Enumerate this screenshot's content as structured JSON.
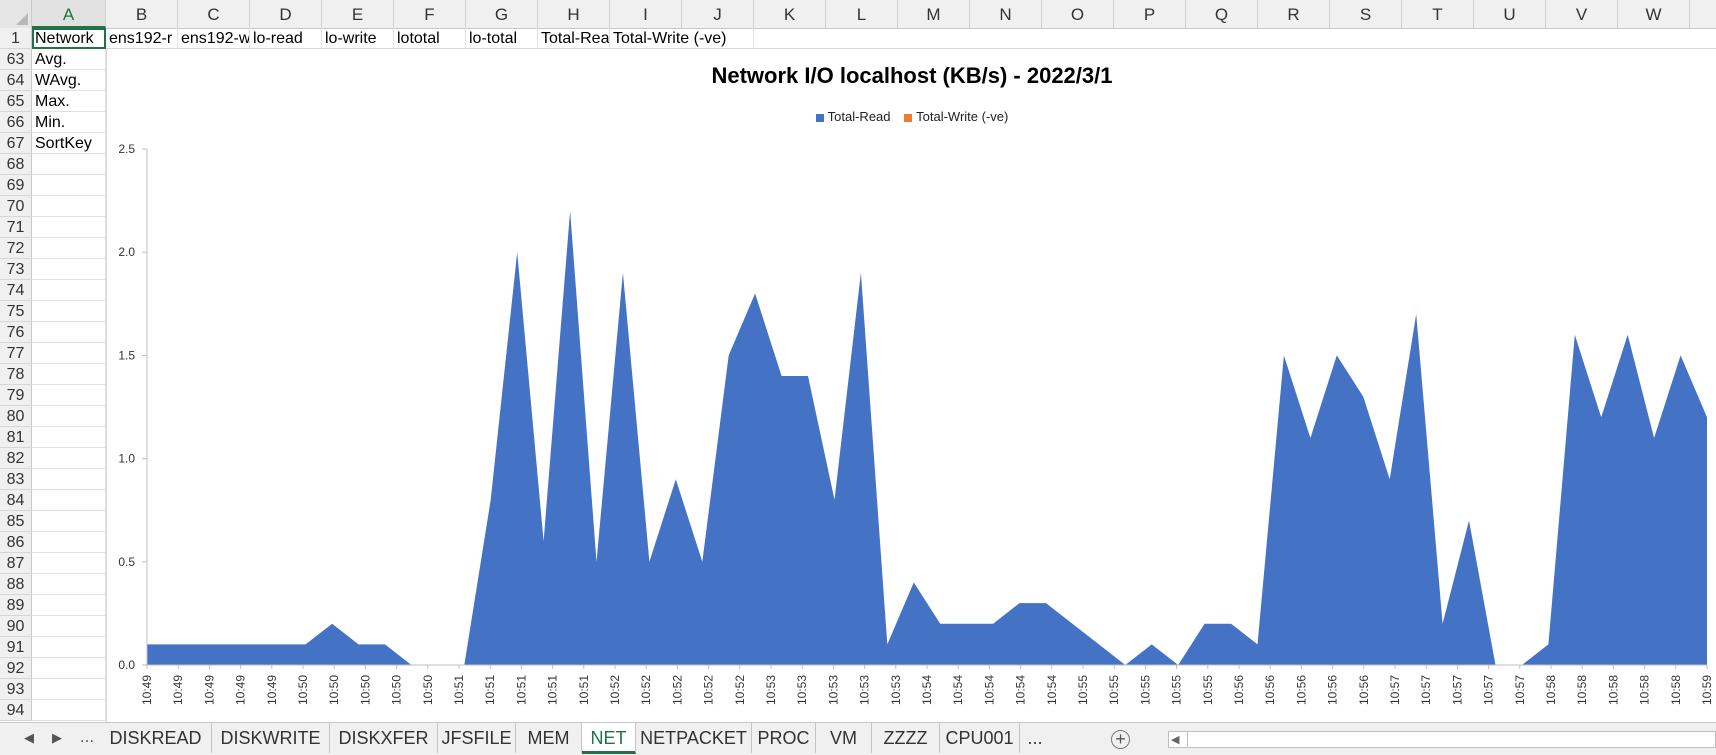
{
  "sheet": {
    "columns": [
      "A",
      "B",
      "C",
      "D",
      "E",
      "F",
      "G",
      "H",
      "I",
      "J",
      "K",
      "L",
      "M",
      "N",
      "O",
      "P",
      "Q",
      "R",
      "S",
      "T",
      "U",
      "V",
      "W"
    ],
    "selected_column": "A",
    "header_row": {
      "number": "1",
      "cells": [
        "Network",
        "ens192-r",
        "ens192-w",
        "lo-read",
        "lo-write",
        "lototal",
        "lo-total",
        "Total-Rea",
        "Total-Write (-ve)"
      ]
    },
    "rows": [
      {
        "number": "63",
        "label": "Avg."
      },
      {
        "number": "64",
        "label": "WAvg."
      },
      {
        "number": "65",
        "label": "Max."
      },
      {
        "number": "66",
        "label": "Min."
      },
      {
        "number": "67",
        "label": "SortKey"
      },
      {
        "number": "68",
        "label": ""
      },
      {
        "number": "69",
        "label": ""
      },
      {
        "number": "70",
        "label": ""
      },
      {
        "number": "71",
        "label": ""
      },
      {
        "number": "72",
        "label": ""
      },
      {
        "number": "73",
        "label": ""
      },
      {
        "number": "74",
        "label": ""
      },
      {
        "number": "75",
        "label": ""
      },
      {
        "number": "76",
        "label": ""
      },
      {
        "number": "77",
        "label": ""
      },
      {
        "number": "78",
        "label": ""
      },
      {
        "number": "79",
        "label": ""
      },
      {
        "number": "80",
        "label": ""
      },
      {
        "number": "81",
        "label": ""
      },
      {
        "number": "82",
        "label": ""
      },
      {
        "number": "83",
        "label": ""
      },
      {
        "number": "84",
        "label": ""
      },
      {
        "number": "85",
        "label": ""
      },
      {
        "number": "86",
        "label": ""
      },
      {
        "number": "87",
        "label": ""
      },
      {
        "number": "88",
        "label": ""
      },
      {
        "number": "89",
        "label": ""
      },
      {
        "number": "90",
        "label": ""
      },
      {
        "number": "91",
        "label": ""
      },
      {
        "number": "92",
        "label": ""
      },
      {
        "number": "93",
        "label": ""
      },
      {
        "number": "94",
        "label": ""
      }
    ]
  },
  "chart_data": {
    "type": "area",
    "title": "Network I/O localhost (KB/s) - 2022/3/1",
    "legend": [
      "Total-Read",
      "Total-Write (-ve)"
    ],
    "legend_position": "top",
    "ylim": [
      0,
      2.5
    ],
    "yticks": [
      "0.0",
      "0.5",
      "1.0",
      "1.5",
      "2.0",
      "2.5"
    ],
    "grid": false,
    "x": [
      "10:49",
      "10:49",
      "10:49",
      "10:49",
      "10:49",
      "10:50",
      "10:50",
      "10:50",
      "10:50",
      "10:50",
      "10:51",
      "10:51",
      "10:51",
      "10:51",
      "10:51",
      "10:52",
      "10:52",
      "10:52",
      "10:52",
      "10:52",
      "10:53",
      "10:53",
      "10:53",
      "10:53",
      "10:53",
      "10:54",
      "10:54",
      "10:54",
      "10:54",
      "10:54",
      "10:55",
      "10:55",
      "10:55",
      "10:55",
      "10:55",
      "10:56",
      "10:56",
      "10:56",
      "10:56",
      "10:56",
      "10:57",
      "10:57",
      "10:57",
      "10:57",
      "10:57",
      "10:58",
      "10:58",
      "10:58",
      "10:58",
      "10:58",
      "10:59"
    ],
    "series": [
      {
        "name": "Total-Read",
        "values": [
          0.1,
          0.1,
          0.1,
          0.1,
          0.1,
          0.1,
          0.1,
          0.2,
          0.1,
          0.1,
          0.0,
          0.0,
          0.0,
          0.8,
          2.0,
          0.6,
          2.2,
          0.5,
          1.9,
          0.5,
          0.9,
          0.5,
          1.5,
          1.8,
          1.4,
          1.4,
          0.8,
          1.9,
          0.1,
          0.4,
          0.2,
          0.2,
          0.2,
          0.3,
          0.3,
          0.2,
          0.1,
          0.0,
          0.1,
          0.0,
          0.2,
          0.2,
          0.1,
          1.5,
          1.1,
          1.5,
          1.3,
          0.9,
          1.7,
          0.2,
          0.7,
          0.0,
          0.0,
          0.1,
          1.6,
          1.2,
          1.6,
          1.1,
          1.5,
          1.2
        ]
      },
      {
        "name": "Total-Write (-ve)",
        "values": []
      }
    ],
    "colors": {
      "Total-Read": "#4472c4",
      "Total-Write (-ve)": "#ed7d31"
    }
  },
  "tabs": {
    "nav": [
      "◀",
      "▶",
      "..."
    ],
    "items": [
      "DISKREAD",
      "DISKWRITE",
      "DISKXFER",
      "JFSFILE",
      "MEM",
      "NET",
      "NETPACKET",
      "PROC",
      "VM",
      "ZZZZ",
      "CPU001",
      "..."
    ],
    "active": "NET",
    "add_label": "+"
  }
}
